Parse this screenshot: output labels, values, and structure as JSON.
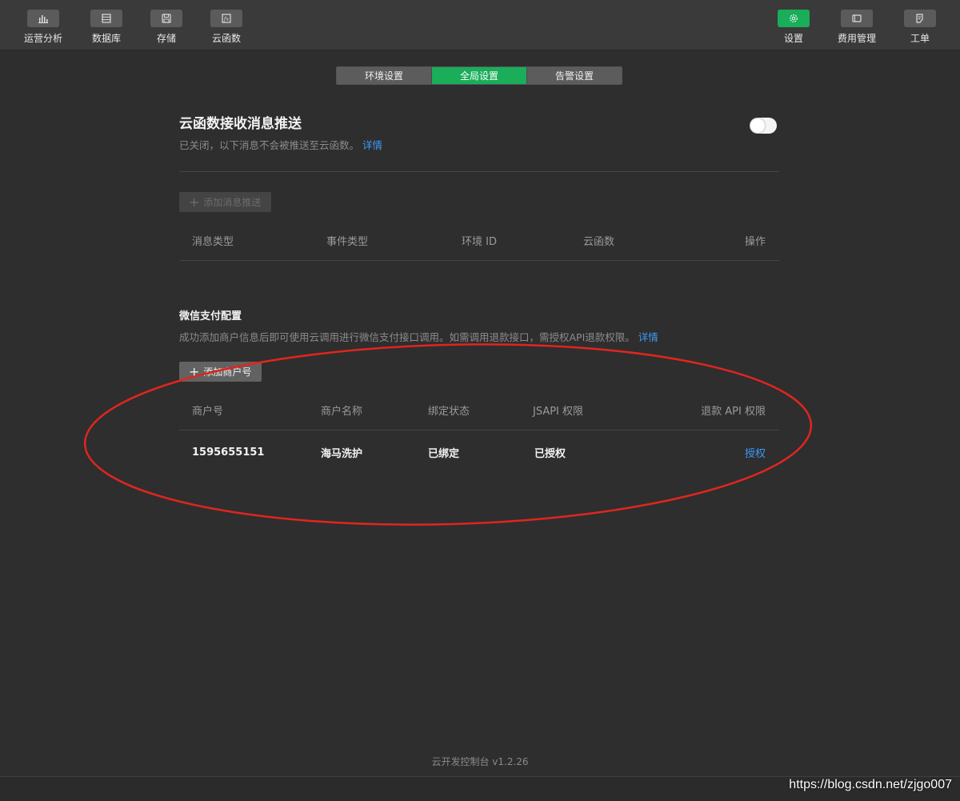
{
  "toolbar": {
    "left_items": [
      {
        "label": "运营分析",
        "icon": "bar-chart-icon"
      },
      {
        "label": "数据库",
        "icon": "database-icon"
      },
      {
        "label": "存储",
        "icon": "storage-icon"
      },
      {
        "label": "云函数",
        "icon": "function-icon"
      }
    ],
    "right_items": [
      {
        "label": "设置",
        "icon": "gear-icon",
        "active": true
      },
      {
        "label": "费用管理",
        "icon": "billing-icon"
      },
      {
        "label": "工单",
        "icon": "ticket-icon"
      }
    ]
  },
  "tabs": [
    {
      "label": "环境设置"
    },
    {
      "label": "全局设置",
      "active": true
    },
    {
      "label": "告警设置"
    }
  ],
  "push": {
    "title": "云函数接收消息推送",
    "desc": "已关闭，以下消息不会被推送至云函数。",
    "detail_link": "详情",
    "toggle_on": false,
    "add_button": "添加消息推送",
    "columns": [
      "消息类型",
      "事件类型",
      "环境 ID",
      "云函数",
      "操作"
    ]
  },
  "wxpay": {
    "title": "微信支付配置",
    "desc": "成功添加商户信息后即可使用云调用进行微信支付接口调用。如需调用退款接口，需授权API退款权限。",
    "detail_link": "详情",
    "add_button": "添加商户号",
    "columns": [
      "商户号",
      "商户名称",
      "绑定状态",
      "JSAPI 权限",
      "退款 API 权限"
    ],
    "rows": [
      {
        "merchant_id": "1595655151",
        "merchant_name": "海马洗护",
        "bind_status": "已绑定",
        "jsapi": "已授权",
        "refund_action": "授权"
      }
    ]
  },
  "footer": {
    "version": "云开发控制台 v1.2.26"
  },
  "watermark": "https://blog.csdn.net/zjgo007",
  "colors": {
    "accent": "#1aad5a",
    "link": "#3d9bf5",
    "annotation": "#e0251f"
  }
}
